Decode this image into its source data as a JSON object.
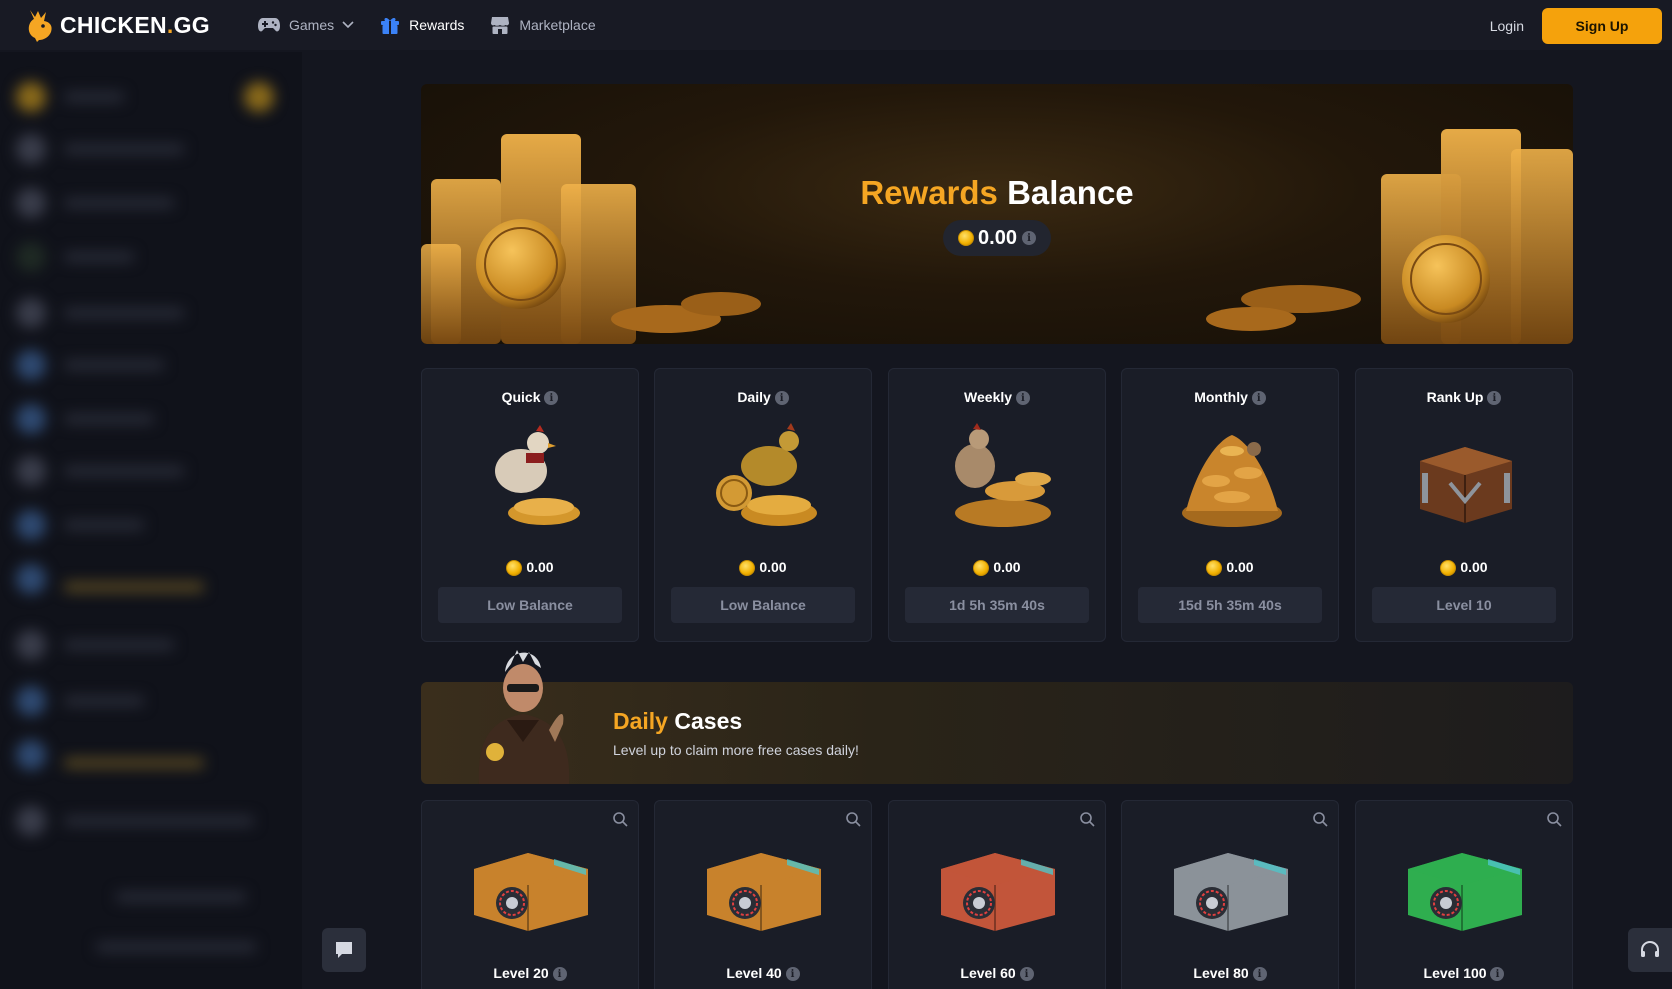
{
  "header": {
    "logo_text": "CHICKEN",
    "logo_dot": ".",
    "logo_suffix": "GG",
    "nav": [
      {
        "label": "Games",
        "icon": "gamepad-icon",
        "has_dropdown": true
      },
      {
        "label": "Rewards",
        "icon": "gift-icon",
        "active": true
      },
      {
        "label": "Marketplace",
        "icon": "store-icon"
      }
    ],
    "login_label": "Login",
    "signup_label": "Sign Up"
  },
  "hero": {
    "title_accent": "Rewards",
    "title_rest": "Balance",
    "balance": "0.00"
  },
  "rewards": [
    {
      "title": "Quick",
      "value": "0.00",
      "button": "Low Balance"
    },
    {
      "title": "Daily",
      "value": "0.00",
      "button": "Low Balance"
    },
    {
      "title": "Weekly",
      "value": "0.00",
      "button": "1d 5h 35m 40s"
    },
    {
      "title": "Monthly",
      "value": "0.00",
      "button": "15d 5h 35m 40s"
    },
    {
      "title": "Rank Up",
      "value": "0.00",
      "button": "Level 10"
    }
  ],
  "daily_cases": {
    "title_accent": "Daily",
    "title_rest": "Cases",
    "subtitle": "Level up to claim more free cases daily!",
    "cases": [
      {
        "label": "Level 20",
        "color": "#c8822c"
      },
      {
        "label": "Level 40",
        "color": "#c8822c"
      },
      {
        "label": "Level 60",
        "color": "#c2553a"
      },
      {
        "label": "Level 80",
        "color": "#8b9299"
      },
      {
        "label": "Level 100",
        "color": "#2fae4f"
      }
    ]
  },
  "colors": {
    "accent": "#f5a623",
    "background": "#14161f",
    "card": "#1a1d27"
  }
}
